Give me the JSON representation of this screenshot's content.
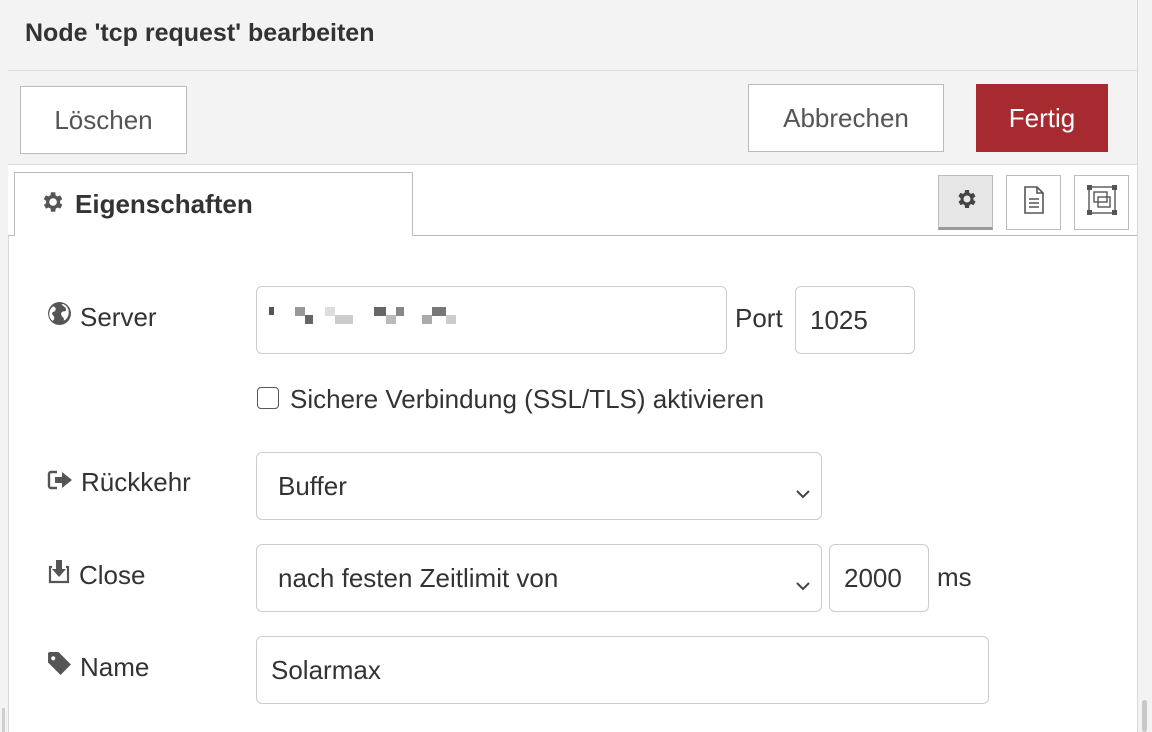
{
  "dialog": {
    "title": "Node 'tcp request' bearbeiten"
  },
  "toolbar": {
    "delete_label": "Löschen",
    "cancel_label": "Abbrechen",
    "done_label": "Fertig",
    "accent_color": "#a72a31"
  },
  "tabs": {
    "properties_label": "Eigenschaften",
    "icons": [
      "gear-icon",
      "document-icon",
      "appearance-icon"
    ]
  },
  "form": {
    "server_label": "Server",
    "server_value": "",
    "port_label": "Port",
    "port_value": "1025",
    "ssl_label": "Sichere Verbindung (SSL/TLS) aktivieren",
    "ssl_checked": false,
    "return_label": "Rückkehr",
    "return_value": "Buffer",
    "close_label": "Close",
    "close_value": "nach festen Zeitlimit von",
    "timeout_value": "2000",
    "timeout_unit": "ms",
    "name_label": "Name",
    "name_value": "Solarmax"
  }
}
